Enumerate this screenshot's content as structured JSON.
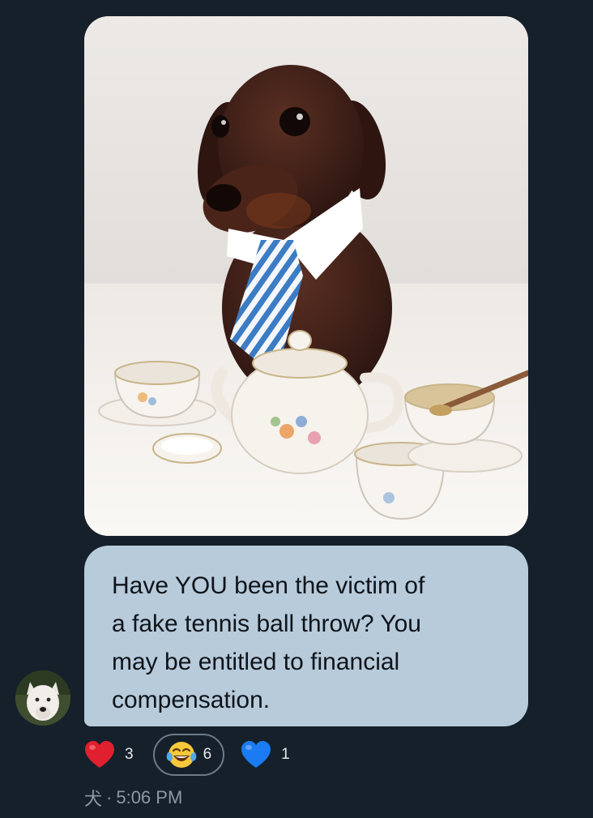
{
  "message": {
    "photo_icon": "dachshund-tea-party-photo",
    "text": "Have YOU been the victim of\na fake tennis ball throw? You\nmay be entitled to financial\ncompensation."
  },
  "sender": {
    "avatar_icon": "white-wolf-avatar"
  },
  "reactions": [
    {
      "emoji": "red-heart",
      "count": "3"
    },
    {
      "emoji": "face-with-tears-of-joy",
      "count": "6",
      "selected": true
    },
    {
      "emoji": "blue-heart",
      "count": "1"
    }
  ],
  "meta": {
    "sender_name": "犬",
    "separator": "·",
    "time": "5:06 PM"
  },
  "colors": {
    "background": "#15202b",
    "bubble": "#b7cbdb",
    "text_dark": "#0f1419",
    "meta_gray": "#8b98a5"
  }
}
